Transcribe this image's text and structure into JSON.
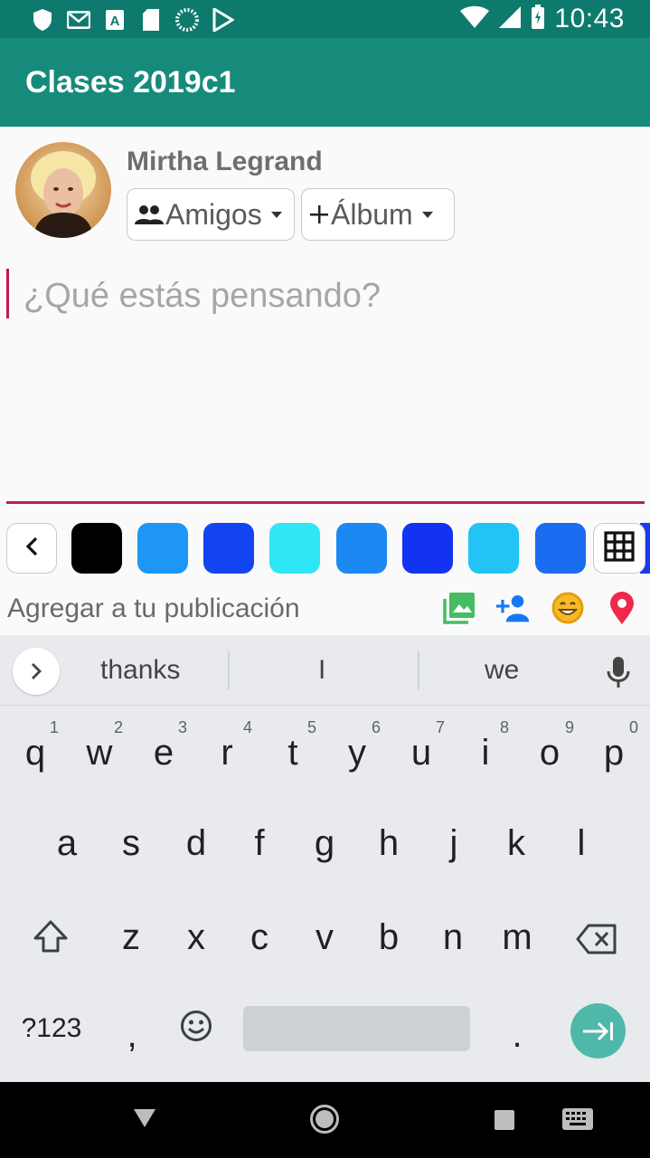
{
  "status_bar": {
    "time": "10:43",
    "icons": [
      "shield-icon",
      "gmail-icon",
      "text-icon",
      "sd-card-icon",
      "sync-icon",
      "play-store-icon",
      "wifi-icon",
      "signal-icon",
      "battery-icon"
    ]
  },
  "app_bar": {
    "title": "Clases 2019c1"
  },
  "profile": {
    "name": "Mirtha Legrand",
    "audience_chip": "Amigos",
    "album_chip": "Álbum"
  },
  "compose": {
    "placeholder": "¿Qué estás pensando?",
    "value": ""
  },
  "color_row": {
    "swatches": [
      "#000000",
      "#1e96f5",
      "#1245f0",
      "#2ee6f5",
      "#1c88f2",
      "#1233f0",
      "#21c4f5",
      "#1a6cf0"
    ]
  },
  "add_to_post": {
    "label": "Agregar a tu publicación",
    "icons": [
      "photo-icon",
      "tag-person-icon",
      "emoji-icon",
      "location-icon"
    ]
  },
  "keyboard": {
    "suggestions": [
      "thanks",
      "I",
      "we"
    ],
    "row1": [
      "q",
      "w",
      "e",
      "r",
      "t",
      "y",
      "u",
      "i",
      "o",
      "p"
    ],
    "row1_hints": [
      "1",
      "2",
      "3",
      "4",
      "5",
      "6",
      "7",
      "8",
      "9",
      "0"
    ],
    "row2": [
      "a",
      "s",
      "d",
      "f",
      "g",
      "h",
      "j",
      "k",
      "l"
    ],
    "row3": [
      "z",
      "x",
      "c",
      "v",
      "b",
      "n",
      "m"
    ],
    "symbols_key": "?123",
    "comma_key": ",",
    "period_key": "."
  },
  "colors": {
    "status_bar": "#0d7a6d",
    "app_bar": "#168b7c",
    "accent": "#c2185b",
    "enter_key": "#4fb8aa"
  }
}
